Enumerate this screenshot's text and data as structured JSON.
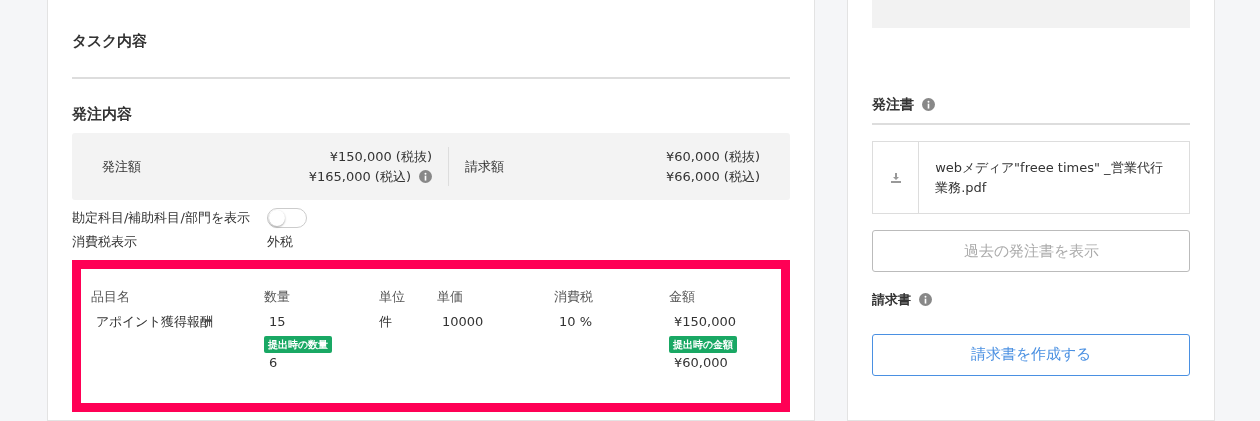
{
  "task_section": {
    "title": "タスク内容"
  },
  "order_section": {
    "title": "発注内容",
    "summary": {
      "order_label": "発注額",
      "order_values": [
        "¥150,000 (税抜)",
        "¥165,000 (税込)"
      ],
      "billing_label": "請求額",
      "billing_values": [
        "¥60,000 (税抜)",
        "¥66,000 (税込)"
      ]
    },
    "toggle": {
      "label": "勘定科目/補助科目/部門を表示",
      "on": false
    },
    "tax_display": {
      "label": "消費税表示",
      "value": "外税"
    },
    "items": {
      "highlighted": true,
      "columns": [
        "品目名",
        "数量",
        "単位",
        "単価",
        "消費税",
        "金額"
      ],
      "rows": [
        {
          "name": "アポイント獲得報酬",
          "quantity": "15",
          "quantity_badge": "提出時の数量",
          "submitted_quantity": "6",
          "unit": "件",
          "unit_price": "10000",
          "tax": "10 %",
          "amount": "¥150,000",
          "amount_badge": "提出時の金額",
          "submitted_amount": "¥60,000"
        }
      ]
    }
  },
  "purchase_order": {
    "title": "発注書",
    "file_name": "webメディア\"freee times\" _営業代行業務.pdf",
    "past_button": {
      "label": "過去の発注書を表示",
      "disabled": true
    }
  },
  "invoice": {
    "title": "請求書",
    "create_button": {
      "label": "請求書を作成する",
      "disabled": false
    }
  }
}
